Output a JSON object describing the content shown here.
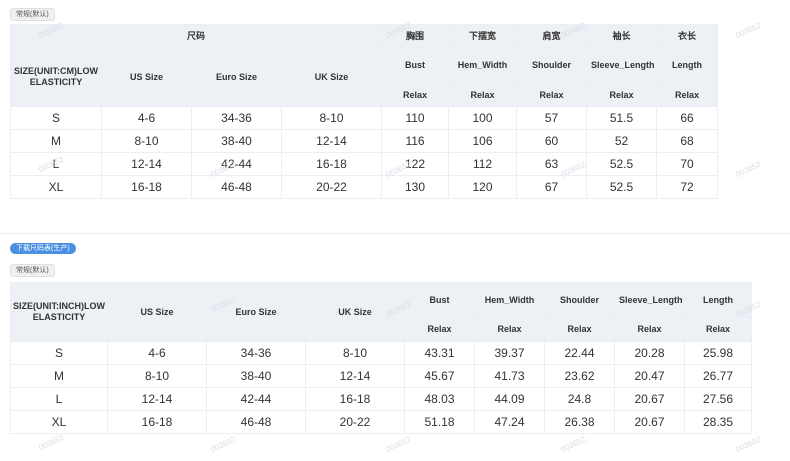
{
  "top_tag": "常规(默认)",
  "download_button": "下载尺码表(生产)",
  "bottom_tag": "常规(默认)",
  "watermark": "003652",
  "cm_table": {
    "size_group_label": "尺码",
    "row_header": "SIZE(UNIT:CM)LOW ELASTICITY",
    "size_columns": [
      "US Size",
      "Euro Size",
      "UK Size"
    ],
    "measure_cn": [
      "胸围",
      "下摆宽",
      "肩宽",
      "袖长",
      "衣长"
    ],
    "measure_en": [
      "Bust",
      "Hem_Width",
      "Shoulder",
      "Sleeve_Length",
      "Length"
    ],
    "fit_labels": [
      "Relax",
      "Relax",
      "Relax",
      "Relax",
      "Relax"
    ],
    "rows": [
      [
        "S",
        "4-6",
        "34-36",
        "8-10",
        "110",
        "100",
        "57",
        "51.5",
        "66"
      ],
      [
        "M",
        "8-10",
        "38-40",
        "12-14",
        "116",
        "106",
        "60",
        "52",
        "68"
      ],
      [
        "L",
        "12-14",
        "42-44",
        "16-18",
        "122",
        "112",
        "63",
        "52.5",
        "70"
      ],
      [
        "XL",
        "16-18",
        "46-48",
        "20-22",
        "130",
        "120",
        "67",
        "52.5",
        "72"
      ]
    ]
  },
  "inch_table": {
    "row_header": "SIZE(UNIT:INCH)LOW ELASTICITY",
    "size_columns": [
      "US Size",
      "Euro Size",
      "UK Size"
    ],
    "measure_en": [
      "Bust",
      "Hem_Width",
      "Shoulder",
      "Sleeve_Length",
      "Length"
    ],
    "fit_labels": [
      "Relax",
      "Relax",
      "Relax",
      "Relax",
      "Relax"
    ],
    "rows": [
      [
        "S",
        "4-6",
        "34-36",
        "8-10",
        "43.31",
        "39.37",
        "22.44",
        "20.28",
        "25.98"
      ],
      [
        "M",
        "8-10",
        "38-40",
        "12-14",
        "45.67",
        "41.73",
        "23.62",
        "20.47",
        "26.77"
      ],
      [
        "L",
        "12-14",
        "42-44",
        "16-18",
        "48.03",
        "44.09",
        "24.8",
        "20.67",
        "27.56"
      ],
      [
        "XL",
        "16-18",
        "46-48",
        "20-22",
        "51.18",
        "47.24",
        "26.38",
        "20.67",
        "28.35"
      ]
    ]
  }
}
